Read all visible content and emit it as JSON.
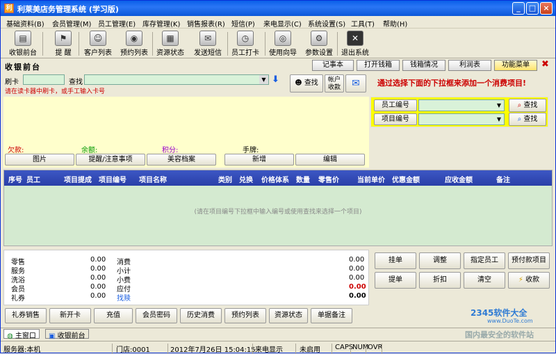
{
  "window": {
    "title": "利莱美店务管理系统 (学习版)"
  },
  "menu": [
    "基础资料(B)",
    "会员管理(M)",
    "员工管理(E)",
    "库存管理(K)",
    "销售报表(R)",
    "短信(P)",
    "来电显示(C)",
    "系统设置(S)",
    "工具(T)",
    "帮助(H)"
  ],
  "toolbar": [
    {
      "label": "收银前台",
      "icon": "cash-register-icon"
    },
    {
      "label": "提 醒",
      "icon": "reminder-icon"
    },
    {
      "label": "客户列表",
      "icon": "customers-icon"
    },
    {
      "label": "预约列表",
      "icon": "appointment-icon"
    },
    {
      "label": "资源状态",
      "icon": "resource-grid-icon"
    },
    {
      "label": "发送短信",
      "icon": "envelope-icon"
    },
    {
      "label": "员工打卡",
      "icon": "clock-icon"
    },
    {
      "label": "使用向导",
      "icon": "eye-icon"
    },
    {
      "label": "参数设置",
      "icon": "settings-icon"
    },
    {
      "label": "退出系统",
      "icon": "exit-icon"
    }
  ],
  "cash": {
    "title": "收银前台",
    "buttons": [
      "记事本",
      "打开钱箱",
      "钱箱情况",
      "利润表",
      "功能菜单"
    ]
  },
  "card": {
    "label": "刷卡",
    "find_label": "查找",
    "hint": "请在读卡器中刷卡，或手工输入卡号",
    "find_button": "查找",
    "account_button": "帐户收款",
    "tip": "通过选择下面的下拉框来添加一个消费项目!"
  },
  "member": {
    "debt_label": "欠款:",
    "balance_label": "余额:",
    "points_label": "积分:",
    "plate_label": "手牌:",
    "buttons": [
      "图片",
      "提醒/注意事项",
      "美容档案"
    ],
    "new_button": "新增",
    "edit_button": "编辑"
  },
  "selectors": {
    "employee_label": "员工编号",
    "item_label": "项目编号",
    "find_label": "查找"
  },
  "grid": {
    "columns": [
      "序号",
      "员工",
      "项目提成",
      "项目编号",
      "项目名称",
      "类别",
      "兑换",
      "价格体系",
      "数量",
      "零售价",
      "当前单价",
      "优惠金额",
      "应收金额",
      "备注"
    ],
    "empty_hint": "(请在项目编号下拉框中输入编号或使用查找来选择一个项目)"
  },
  "summary": {
    "left": [
      {
        "label": "零售",
        "value": "0.00"
      },
      {
        "label": "服务",
        "value": "0.00"
      },
      {
        "label": "洗浴",
        "value": "0.00"
      },
      {
        "label": "会员",
        "value": "0.00"
      },
      {
        "label": "礼券",
        "value": "0.00"
      }
    ],
    "right": [
      {
        "label": "消费",
        "value": "0.00"
      },
      {
        "label": "小计",
        "value": "0.00"
      },
      {
        "label": "小费",
        "value": "0.00"
      },
      {
        "label": "应付",
        "value": "0.00"
      },
      {
        "label": "找赎",
        "value": "0.00"
      }
    ]
  },
  "actions": [
    "挂单",
    "调整",
    "指定员工",
    "预付款项目",
    "提单",
    "折扣",
    "清空",
    "收款"
  ],
  "bottom_buttons": [
    "礼券销售",
    "新开卡",
    "充值",
    "会员密码",
    "历史消费",
    "预约列表",
    "资源状态",
    "单据备注"
  ],
  "tabs": [
    "主窗口",
    "收银前台"
  ],
  "status": {
    "server": "服务器:本机",
    "store": "门店:0001",
    "datetime": "2012年7月26日 15:04:15",
    "caller": "来电显示",
    "caller_state": "未启用",
    "caps": "CAPS",
    "num": "NUM",
    "ovr": "OVR"
  },
  "watermark": {
    "brand": "2345软件大全",
    "site": "www.DuoTe.com",
    "slogan": "国内最安全的软件站"
  },
  "colors": {
    "titlebar": "#0a5fe8",
    "grid_header": "#2a3fa8",
    "highlight": "#ffff00",
    "memo": "#ffffcc",
    "alert_red": "#cc0000"
  }
}
